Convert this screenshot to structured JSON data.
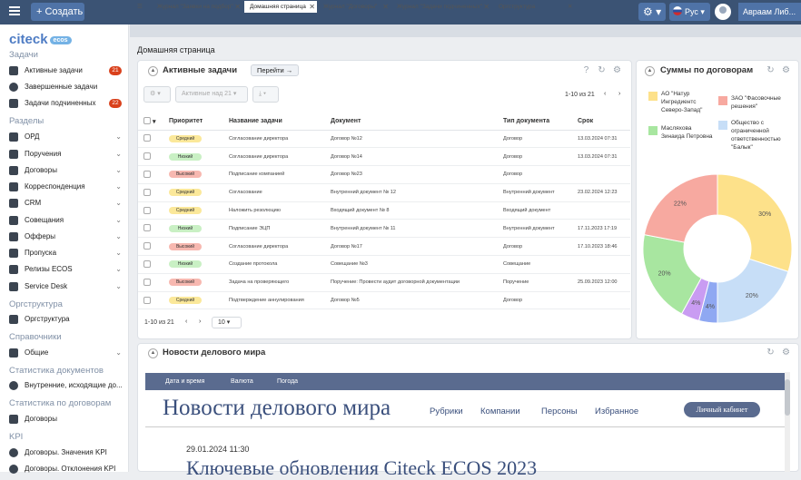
{
  "topbar": {
    "create_label": "Создать",
    "lang": "Рус",
    "user": "Авраам Либ..."
  },
  "sidebar": {
    "logo": "citeck",
    "logo_badge": "ecos",
    "sections": {
      "tasks": "Задачи",
      "sections": "Разделы",
      "orgstructure": "Оргструктура",
      "references": "Справочники",
      "doc_stats": "Статистика документов",
      "contract_stats": "Статистика по договорам",
      "kpi": "KPI"
    },
    "tasks": [
      {
        "label": "Активные задачи",
        "badge": "21"
      },
      {
        "label": "Завершенные задачи",
        "badge": ""
      },
      {
        "label": "Задачи подчиненных",
        "badge": "22"
      }
    ],
    "sections_items": [
      "ОРД",
      "Поручения",
      "Договоры",
      "Корреспонденция",
      "CRM",
      "Совещания",
      "Офферы",
      "Пропуска",
      "Релизы ECOS",
      "Service Desk"
    ],
    "org_items": [
      "Оргструктура"
    ],
    "ref_items": [
      "Общие"
    ],
    "doc_stat_items": [
      "Внутренние, исходящие до..."
    ],
    "contract_items": [
      "Договоры"
    ],
    "kpi_items": [
      "Договоры. Значения KPI",
      "Договоры. Отклонения KPI"
    ]
  },
  "tabs": [
    "Журнал \"Заявки на подбор\"",
    "Домашняя страница",
    "Журнал \"Договоры\"",
    "Журнал \"Задачи подчиненных\"",
    "Оргструктура"
  ],
  "page_title": "Домашняя страница",
  "tasks_panel": {
    "title": "Активные задачи",
    "goto_label": "Перейти →",
    "filter_placeholder": "Активные над 21",
    "page_info": "1-10 из 21",
    "page_size": "10",
    "columns": [
      "Приоритет",
      "Название задачи",
      "Документ",
      "Тип документа",
      "Срок"
    ],
    "rows": [
      {
        "priority": "Средний",
        "task": "Согласование директора",
        "doc": "Договор №12",
        "type": "Договор",
        "due": "13.03.2024 07:31"
      },
      {
        "priority": "Низкий",
        "task": "Согласование директора",
        "doc": "Договор №14",
        "type": "Договор",
        "due": "13.03.2024 07:31"
      },
      {
        "priority": "Высокий",
        "task": "Подписание компанией",
        "doc": "Договор №23",
        "type": "Договор",
        "due": ""
      },
      {
        "priority": "Средний",
        "task": "Согласование",
        "doc": "Внутренний документ № 12",
        "type": "Внутренний документ",
        "due": "23.02.2024 12:23"
      },
      {
        "priority": "Средний",
        "task": "Наложить резолюцию",
        "doc": "Входящий документ № 8",
        "type": "Входящий документ",
        "due": ""
      },
      {
        "priority": "Низкий",
        "task": "Подписание ЭЦП",
        "doc": "Внутренний документ № 11",
        "type": "Внутренний документ",
        "due": "17.11.2023 17:19"
      },
      {
        "priority": "Высокий",
        "task": "Согласование директора",
        "doc": "Договор №17",
        "type": "Договор",
        "due": "17.10.2023 18:46"
      },
      {
        "priority": "Низкий",
        "task": "Создание протокола",
        "doc": "Совещание №3",
        "type": "Совещание",
        "due": ""
      },
      {
        "priority": "Высокий",
        "task": "Задача на проверяющего",
        "doc": "Поручение: Провести аудит договорной документации",
        "type": "Поручение",
        "due": "25.09.2023 12:00"
      },
      {
        "priority": "Средний",
        "task": "Подтверждение аннулирования",
        "doc": "Договор №5",
        "type": "Договор",
        "due": ""
      }
    ],
    "priority_colors": {
      "Средний": "#fbe89a",
      "Низкий": "#c9f0c4",
      "Высокий": "#f7b8b0"
    }
  },
  "pie_panel": {
    "title": "Суммы по договорам",
    "legend": [
      {
        "label": "АО \"Натур Ингредиентс Северо-Запад\"",
        "color": "#fde18a"
      },
      {
        "label": "ЗАО \"Фасовочные решения\"",
        "color": "#f7a9a0"
      },
      {
        "label": "Масляхова Зинаида Петровна",
        "color": "#a8e6a0"
      },
      {
        "label": "Общество с ограниченной ответственностью \"Балык\"",
        "color": "#c7def7"
      }
    ]
  },
  "chart_data": {
    "type": "pie",
    "categories": [
      "30%",
      "20%",
      "4%",
      "4%",
      "20%",
      "22%"
    ],
    "values": [
      30,
      20,
      4,
      4,
      20,
      22
    ],
    "colors": [
      "#fde18a",
      "#c7def7",
      "#8fa8f2",
      "#c99cf2",
      "#a8e6a0",
      "#f7a9a0"
    ]
  },
  "news_panel": {
    "title": "Новости делового мира",
    "nav": [
      "Дата и время",
      "Валюта",
      "Погода"
    ],
    "site_title": "Новости делового мира",
    "menu": [
      "Рубрики",
      "Компании",
      "Персоны",
      "Избранное"
    ],
    "cabinet": "Личный кабинет",
    "date": "29.01.2024 11:30",
    "headline": "Ключевые обновления Citeck ECOS 2023"
  }
}
